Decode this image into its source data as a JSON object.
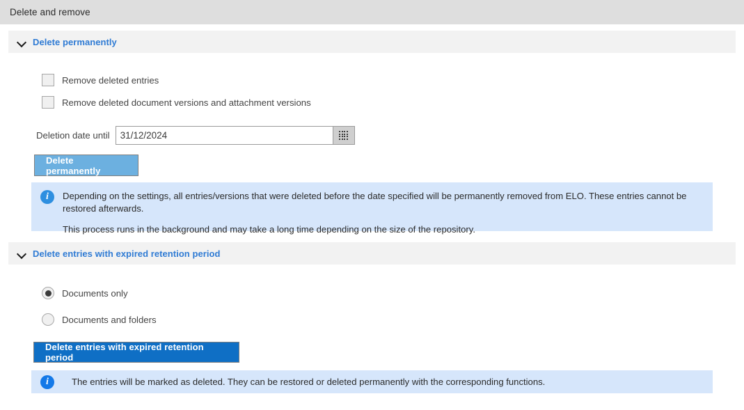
{
  "window": {
    "title": "Delete and remove"
  },
  "sections": [
    {
      "title": "Delete permanently",
      "chevron_icon": "chevron-down-icon",
      "checkboxes": [
        {
          "label": "Remove deleted entries",
          "checked": false
        },
        {
          "label": "Remove deleted document versions and attachment versions",
          "checked": false
        }
      ],
      "date_field": {
        "label": "Deletion date until",
        "value": "31/12/2024",
        "placeholder": "DD/MM/YYYY",
        "picker_icon": "calendar-grid-icon"
      },
      "button": {
        "label": "Delete permanently",
        "state": "disabled",
        "color": "#6cb0e0"
      },
      "info": {
        "icon": "info-circle-icon",
        "icon_color": "#2e8fe0",
        "background": "#d6e6fb",
        "paragraphs": [
          "Depending on the settings, all entries/versions that were deleted before the date specified will be permanently removed from ELO. These entries cannot be restored afterwards.",
          "This process runs in the background and may take a long time depending on the size of the repository."
        ]
      }
    },
    {
      "title": "Delete entries with expired retention period",
      "chevron_icon": "chevron-down-icon",
      "radios": [
        {
          "label": "Documents only",
          "checked": true
        },
        {
          "label": "Documents and folders",
          "checked": false
        }
      ],
      "button": {
        "label": "Delete entries with expired retention period",
        "state": "enabled",
        "color": "#0f6fc5"
      },
      "info": {
        "icon": "info-circle-icon",
        "icon_color": "#1479e8",
        "background": "#d6e6fb",
        "paragraphs": [
          "The entries will be marked as deleted. They can be restored or deleted permanently with the corresponding functions."
        ]
      }
    }
  ],
  "colors": {
    "titlebar": "#dedede",
    "section_header": "#f2f2f2",
    "section_title": "#2f7bd4",
    "info_background": "#d6e6fb"
  },
  "icons": {
    "info_glyph": "i"
  }
}
